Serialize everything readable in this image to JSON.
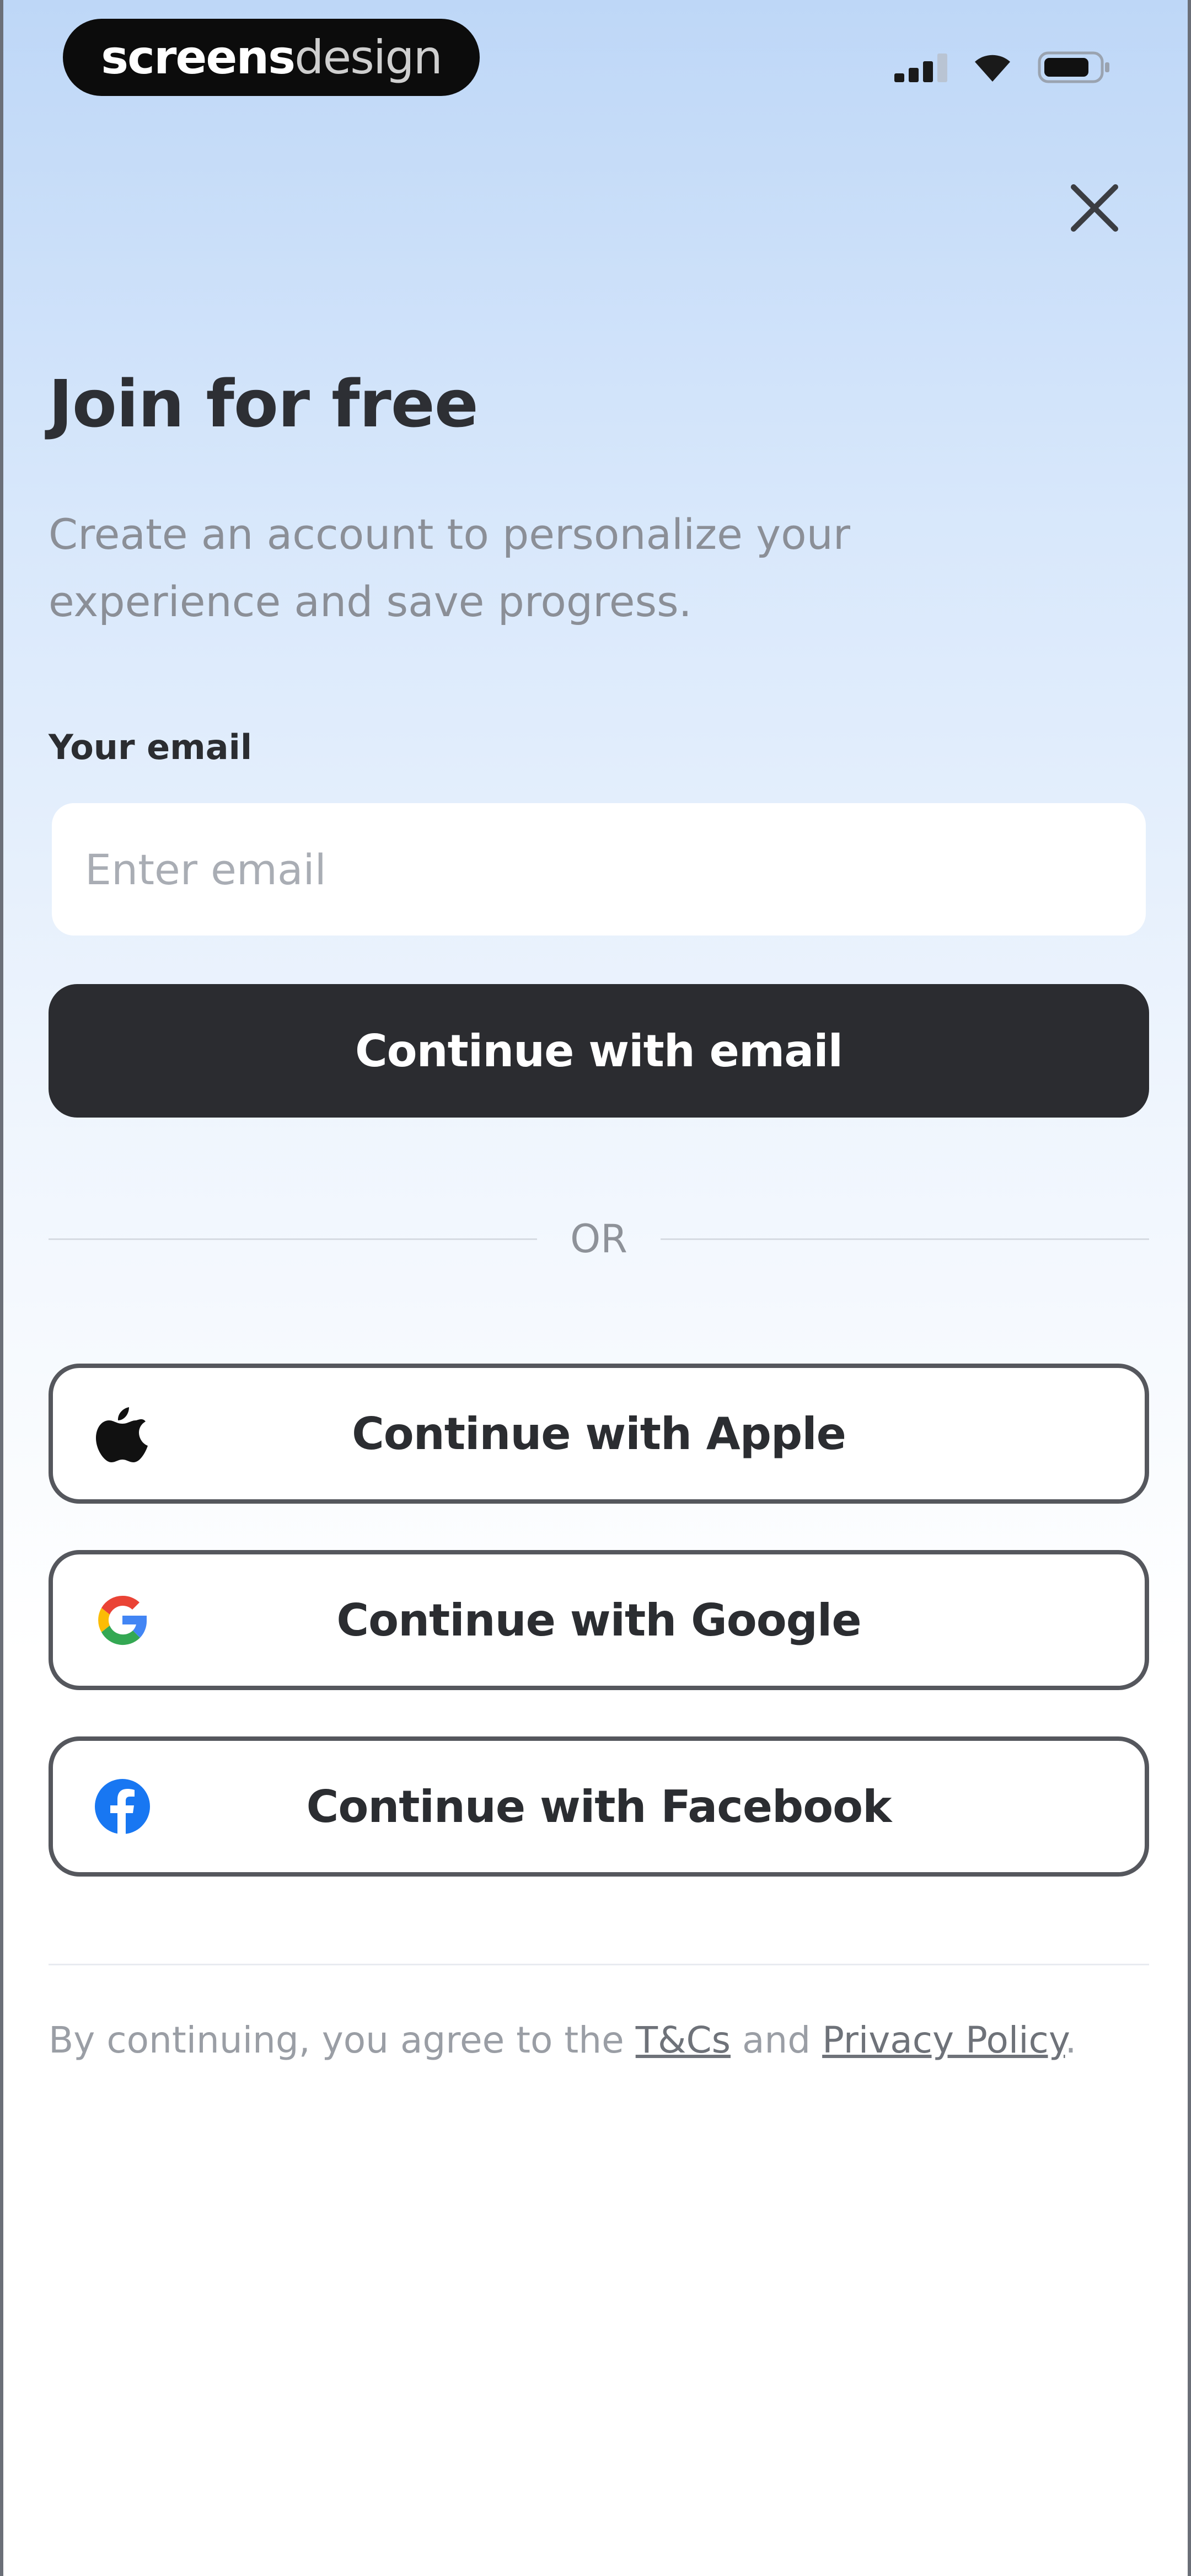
{
  "status_bar": {
    "brand_bold": "screens",
    "brand_light": "design",
    "icons": [
      "signal-icon",
      "wifi-icon",
      "battery-icon"
    ]
  },
  "header": {
    "close_icon": "close-icon"
  },
  "main": {
    "title": "Join for free",
    "subtitle": "Create an account to personalize your experience and save progress.",
    "email_label": "Your email",
    "email_placeholder": "Enter email",
    "email_value": "",
    "continue_email_label": "Continue with email",
    "divider_text": "OR"
  },
  "social": {
    "apple_label": "Continue with Apple",
    "google_label": "Continue with Google",
    "facebook_label": "Continue with Facebook",
    "icons": [
      "apple-icon",
      "google-icon",
      "facebook-icon"
    ]
  },
  "footer": {
    "legal_prefix": "By continuing, you agree to the ",
    "terms_label": "T&Cs",
    "legal_and": " and ",
    "privacy_label": "Privacy Policy",
    "legal_suffix": "."
  },
  "colors": {
    "primary_button": "#2b2c30",
    "background_top": "#bed7f7",
    "facebook_blue": "#1877f2",
    "google_blue": "#4285f4",
    "google_red": "#ea4335",
    "google_yellow": "#fbbc05",
    "google_green": "#34a853"
  }
}
